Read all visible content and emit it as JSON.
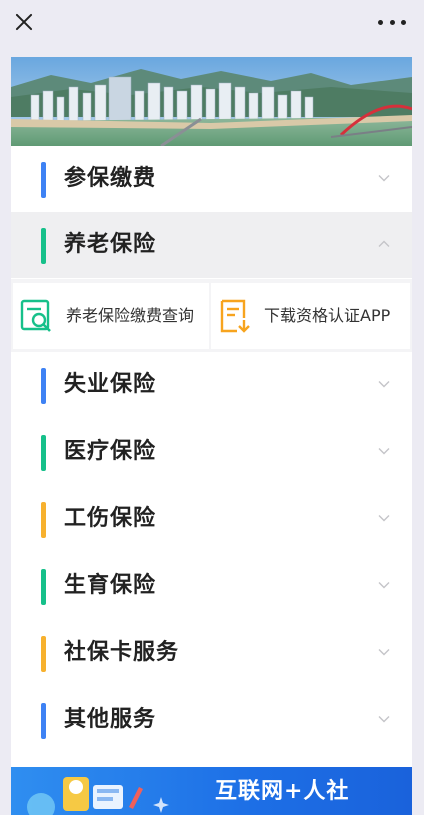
{
  "colors": {
    "blue": "#3e82f4",
    "green": "#16c08a",
    "orange": "#f7b12e",
    "expanded_bg": "#efeff1"
  },
  "topbar": {
    "close_icon": "close-icon",
    "more_icon": "more-horizontal-icon"
  },
  "menu": {
    "items": [
      {
        "label": "参保缴费",
        "accent": "blue",
        "state": "collapsed"
      },
      {
        "label": "养老保险",
        "accent": "green",
        "state": "expanded"
      },
      {
        "label": "失业保险",
        "accent": "blue",
        "state": "collapsed"
      },
      {
        "label": "医疗保险",
        "accent": "green",
        "state": "collapsed"
      },
      {
        "label": "工伤保险",
        "accent": "orange",
        "state": "collapsed"
      },
      {
        "label": "生育保险",
        "accent": "green",
        "state": "collapsed"
      },
      {
        "label": "社保卡服务",
        "accent": "orange",
        "state": "collapsed"
      },
      {
        "label": "其他服务",
        "accent": "blue",
        "state": "collapsed"
      }
    ]
  },
  "pension_submenu": {
    "items": [
      {
        "label": "养老保险缴费查询",
        "icon": "search-document-icon"
      },
      {
        "label": "下载资格认证APP",
        "icon": "download-document-icon"
      }
    ]
  },
  "footer_banner": {
    "title": "互联网+人社"
  }
}
